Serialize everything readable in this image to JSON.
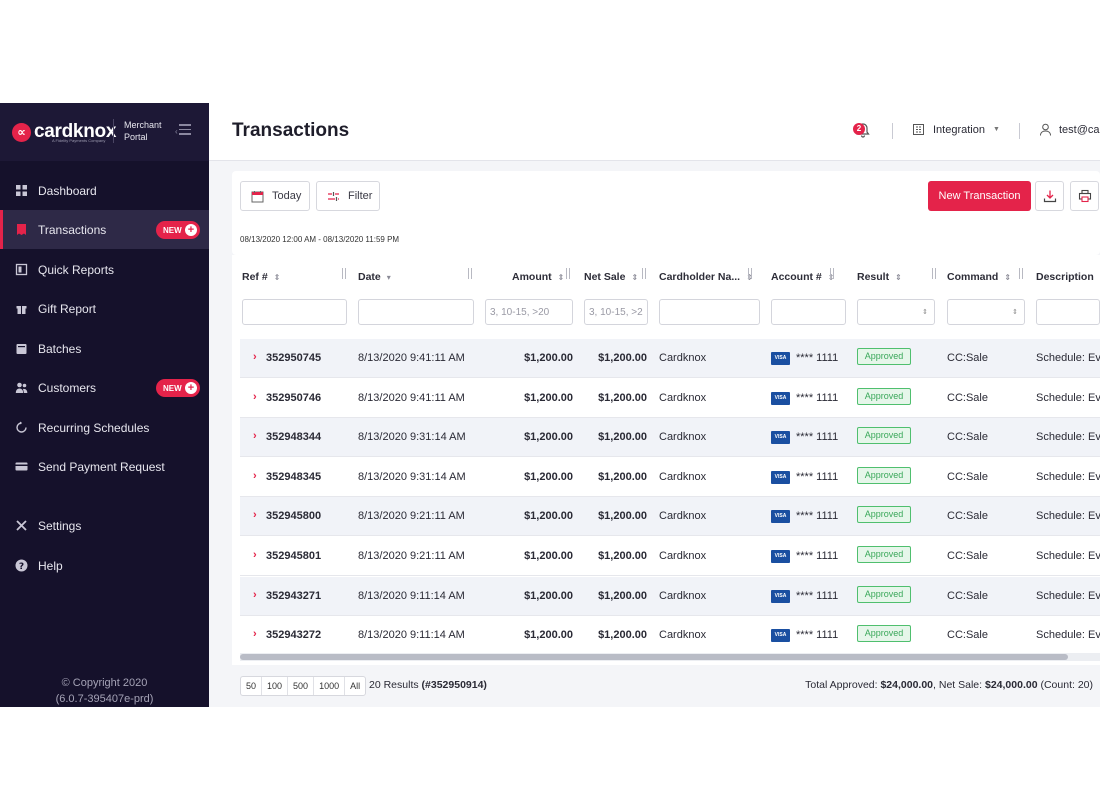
{
  "brand": {
    "name": "cardknox",
    "mark": "∝",
    "tagline": "A Fidelity Payments Company",
    "portal_line1": "Merchant",
    "portal_line2": "Portal"
  },
  "sidebar": {
    "items": [
      {
        "label": "Dashboard",
        "icon": "grid-icon"
      },
      {
        "label": "Transactions",
        "icon": "receipt-icon",
        "badge": "NEW",
        "active": true
      },
      {
        "label": "Quick Reports",
        "icon": "book-icon"
      },
      {
        "label": "Gift Report",
        "icon": "gift-icon"
      },
      {
        "label": "Batches",
        "icon": "batches-icon"
      },
      {
        "label": "Customers",
        "icon": "customers-icon",
        "badge": "NEW"
      },
      {
        "label": "Recurring Schedules",
        "icon": "recurring-icon"
      },
      {
        "label": "Send Payment Request",
        "icon": "card-icon"
      },
      {
        "label": "Settings",
        "icon": "tools-icon"
      },
      {
        "label": "Help",
        "icon": "help-icon"
      }
    ],
    "copyright": "© Copyright 2020",
    "version": "(6.0.7-395407e-prd)"
  },
  "header": {
    "title": "Transactions",
    "notification_count": "2",
    "account": "Integration",
    "user": "test@ca"
  },
  "toolbar": {
    "today_label": "Today",
    "filter_label": "Filter",
    "new_transaction_label": "New Transaction",
    "date_range": "08/13/2020 12:00 AM - 08/13/2020 11:59 PM"
  },
  "table": {
    "columns": [
      "Ref #",
      "Date",
      "Amount",
      "Net Sale",
      "Cardholder Na...",
      "Account #",
      "Result",
      "Command",
      "Description"
    ],
    "filter_placeholders": {
      "amount": "3, 10-15, >20",
      "net_sale": "3, 10-15, >2"
    },
    "rows": [
      {
        "ref": "352950745",
        "date": "8/13/2020 9:41:11 AM",
        "amount": "$1,200.00",
        "net_sale": "$1,200.00",
        "cardholder": "Cardknox",
        "card_brand": "VISA",
        "account": "**** 1111",
        "result": "Approved",
        "command": "CC:Sale",
        "description": "Schedule: Eve"
      },
      {
        "ref": "352950746",
        "date": "8/13/2020 9:41:11 AM",
        "amount": "$1,200.00",
        "net_sale": "$1,200.00",
        "cardholder": "Cardknox",
        "card_brand": "VISA",
        "account": "**** 1111",
        "result": "Approved",
        "command": "CC:Sale",
        "description": "Schedule: Eve"
      },
      {
        "ref": "352948344",
        "date": "8/13/2020 9:31:14 AM",
        "amount": "$1,200.00",
        "net_sale": "$1,200.00",
        "cardholder": "Cardknox",
        "card_brand": "VISA",
        "account": "**** 1111",
        "result": "Approved",
        "command": "CC:Sale",
        "description": "Schedule: Eve"
      },
      {
        "ref": "352948345",
        "date": "8/13/2020 9:31:14 AM",
        "amount": "$1,200.00",
        "net_sale": "$1,200.00",
        "cardholder": "Cardknox",
        "card_brand": "VISA",
        "account": "**** 1111",
        "result": "Approved",
        "command": "CC:Sale",
        "description": "Schedule: Eve"
      },
      {
        "ref": "352945800",
        "date": "8/13/2020 9:21:11 AM",
        "amount": "$1,200.00",
        "net_sale": "$1,200.00",
        "cardholder": "Cardknox",
        "card_brand": "VISA",
        "account": "**** 1111",
        "result": "Approved",
        "command": "CC:Sale",
        "description": "Schedule: Eve"
      },
      {
        "ref": "352945801",
        "date": "8/13/2020 9:21:11 AM",
        "amount": "$1,200.00",
        "net_sale": "$1,200.00",
        "cardholder": "Cardknox",
        "card_brand": "VISA",
        "account": "**** 1111",
        "result": "Approved",
        "command": "CC:Sale",
        "description": "Schedule: Eve"
      },
      {
        "ref": "352943271",
        "date": "8/13/2020 9:11:14 AM",
        "amount": "$1,200.00",
        "net_sale": "$1,200.00",
        "cardholder": "Cardknox",
        "card_brand": "VISA",
        "account": "**** 1111",
        "result": "Approved",
        "command": "CC:Sale",
        "description": "Schedule: Eve"
      },
      {
        "ref": "352943272",
        "date": "8/13/2020 9:11:14 AM",
        "amount": "$1,200.00",
        "net_sale": "$1,200.00",
        "cardholder": "Cardknox",
        "card_brand": "VISA",
        "account": "**** 1111",
        "result": "Approved",
        "command": "CC:Sale",
        "description": "Schedule: Eve"
      }
    ]
  },
  "footer": {
    "page_sizes": [
      "50",
      "100",
      "500",
      "1000",
      "All"
    ],
    "results_count": "20 Results",
    "results_ref": "(#352950914)",
    "total_approved_label": "Total Approved:",
    "total_approved": "$24,000.00",
    "net_sale_label": ", Net Sale:",
    "net_sale": "$24,000.00",
    "count": "(Count: 20)"
  },
  "colors": {
    "accent": "#e4234a",
    "sidebar": "#15112b",
    "approved": "#3aa85a",
    "visa": "#1a4fa1"
  }
}
